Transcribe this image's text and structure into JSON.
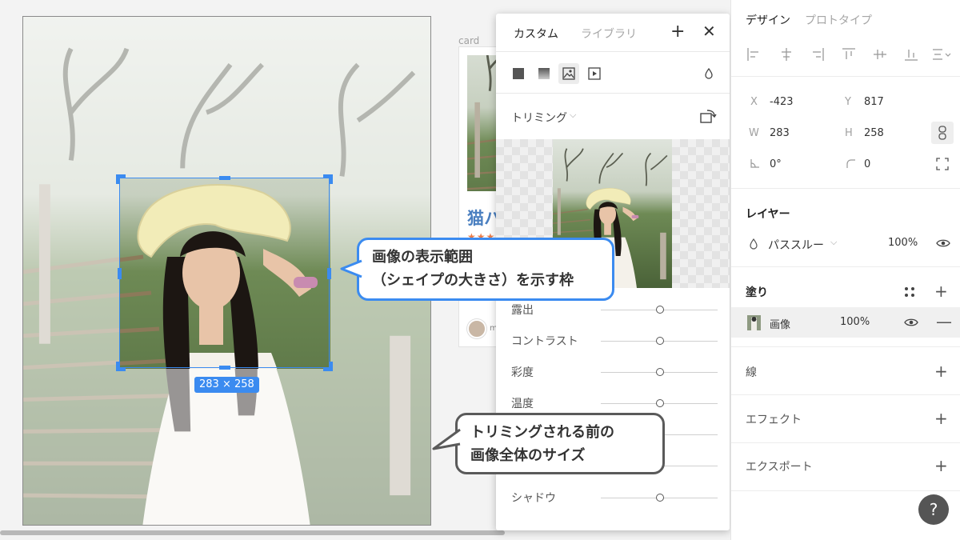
{
  "popup": {
    "tab_custom": "カスタム",
    "tab_library": "ライブラリ",
    "mode_label": "トリミング",
    "adjustments": [
      {
        "label": "露出"
      },
      {
        "label": "コントラスト"
      },
      {
        "label": "彩度"
      },
      {
        "label": "温度"
      },
      {
        "label": ""
      },
      {
        "label": ""
      },
      {
        "label": "シャドウ"
      }
    ]
  },
  "canvas": {
    "size_badge": "283 × 258"
  },
  "card": {
    "label": "card",
    "title": "猫ハ",
    "stars": "★★★",
    "meta": "m"
  },
  "right_panel": {
    "tab_design": "デザイン",
    "tab_prototype": "プロトタイプ",
    "x_key": "X",
    "x_val": "-423",
    "y_key": "Y",
    "y_val": "817",
    "w_key": "W",
    "w_val": "283",
    "h_key": "H",
    "h_val": "258",
    "rotation_val": "0°",
    "radius_val": "0",
    "layer_title": "レイヤー",
    "blend_mode": "パススルー",
    "layer_opacity": "100%",
    "fill_title": "塗り",
    "fill_name": "画像",
    "fill_opacity": "100%",
    "stroke_title": "線",
    "effect_title": "エフェクト",
    "export_title": "エクスポート"
  },
  "help": "?",
  "callouts": {
    "frame": [
      "画像の表示範囲",
      "（シェイプの大きさ）を示す枠"
    ],
    "original": [
      "トリミングされる前の",
      "画像全体のサイズ"
    ]
  },
  "colors": {
    "selection_blue": "#3b8bf0",
    "callout_dark": "#5a5a5a"
  }
}
